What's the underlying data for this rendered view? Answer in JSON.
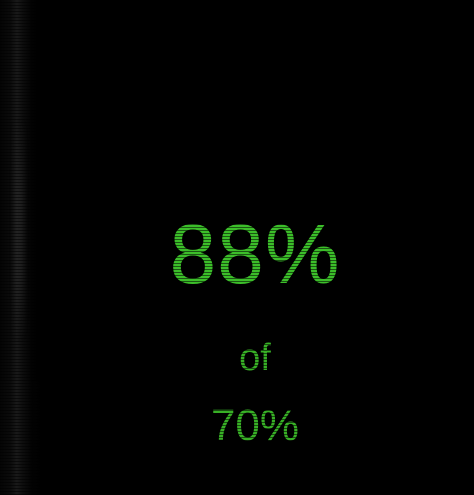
{
  "readout": {
    "current_value": "88%",
    "separator": "of",
    "target_value": "70%"
  },
  "colors": {
    "background": "#000000",
    "text_green": "#3cbe2a"
  }
}
